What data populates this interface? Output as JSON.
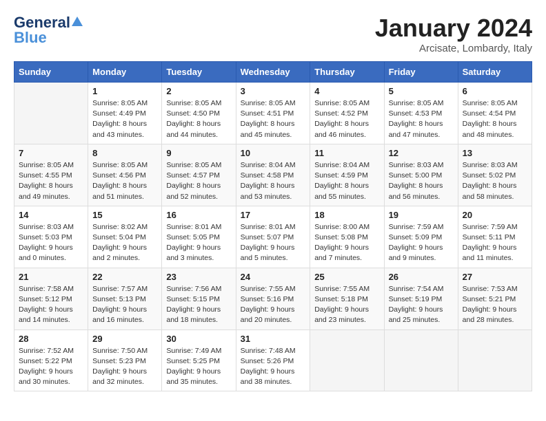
{
  "header": {
    "logo_general": "General",
    "logo_blue": "Blue",
    "month_title": "January 2024",
    "subtitle": "Arcisate, Lombardy, Italy"
  },
  "columns": [
    "Sunday",
    "Monday",
    "Tuesday",
    "Wednesday",
    "Thursday",
    "Friday",
    "Saturday"
  ],
  "weeks": [
    [
      {
        "day": "",
        "info": ""
      },
      {
        "day": "1",
        "info": "Sunrise: 8:05 AM\nSunset: 4:49 PM\nDaylight: 8 hours\nand 43 minutes."
      },
      {
        "day": "2",
        "info": "Sunrise: 8:05 AM\nSunset: 4:50 PM\nDaylight: 8 hours\nand 44 minutes."
      },
      {
        "day": "3",
        "info": "Sunrise: 8:05 AM\nSunset: 4:51 PM\nDaylight: 8 hours\nand 45 minutes."
      },
      {
        "day": "4",
        "info": "Sunrise: 8:05 AM\nSunset: 4:52 PM\nDaylight: 8 hours\nand 46 minutes."
      },
      {
        "day": "5",
        "info": "Sunrise: 8:05 AM\nSunset: 4:53 PM\nDaylight: 8 hours\nand 47 minutes."
      },
      {
        "day": "6",
        "info": "Sunrise: 8:05 AM\nSunset: 4:54 PM\nDaylight: 8 hours\nand 48 minutes."
      }
    ],
    [
      {
        "day": "7",
        "info": "Sunrise: 8:05 AM\nSunset: 4:55 PM\nDaylight: 8 hours\nand 49 minutes."
      },
      {
        "day": "8",
        "info": "Sunrise: 8:05 AM\nSunset: 4:56 PM\nDaylight: 8 hours\nand 51 minutes."
      },
      {
        "day": "9",
        "info": "Sunrise: 8:05 AM\nSunset: 4:57 PM\nDaylight: 8 hours\nand 52 minutes."
      },
      {
        "day": "10",
        "info": "Sunrise: 8:04 AM\nSunset: 4:58 PM\nDaylight: 8 hours\nand 53 minutes."
      },
      {
        "day": "11",
        "info": "Sunrise: 8:04 AM\nSunset: 4:59 PM\nDaylight: 8 hours\nand 55 minutes."
      },
      {
        "day": "12",
        "info": "Sunrise: 8:03 AM\nSunset: 5:00 PM\nDaylight: 8 hours\nand 56 minutes."
      },
      {
        "day": "13",
        "info": "Sunrise: 8:03 AM\nSunset: 5:02 PM\nDaylight: 8 hours\nand 58 minutes."
      }
    ],
    [
      {
        "day": "14",
        "info": "Sunrise: 8:03 AM\nSunset: 5:03 PM\nDaylight: 9 hours\nand 0 minutes."
      },
      {
        "day": "15",
        "info": "Sunrise: 8:02 AM\nSunset: 5:04 PM\nDaylight: 9 hours\nand 2 minutes."
      },
      {
        "day": "16",
        "info": "Sunrise: 8:01 AM\nSunset: 5:05 PM\nDaylight: 9 hours\nand 3 minutes."
      },
      {
        "day": "17",
        "info": "Sunrise: 8:01 AM\nSunset: 5:07 PM\nDaylight: 9 hours\nand 5 minutes."
      },
      {
        "day": "18",
        "info": "Sunrise: 8:00 AM\nSunset: 5:08 PM\nDaylight: 9 hours\nand 7 minutes."
      },
      {
        "day": "19",
        "info": "Sunrise: 7:59 AM\nSunset: 5:09 PM\nDaylight: 9 hours\nand 9 minutes."
      },
      {
        "day": "20",
        "info": "Sunrise: 7:59 AM\nSunset: 5:11 PM\nDaylight: 9 hours\nand 11 minutes."
      }
    ],
    [
      {
        "day": "21",
        "info": "Sunrise: 7:58 AM\nSunset: 5:12 PM\nDaylight: 9 hours\nand 14 minutes."
      },
      {
        "day": "22",
        "info": "Sunrise: 7:57 AM\nSunset: 5:13 PM\nDaylight: 9 hours\nand 16 minutes."
      },
      {
        "day": "23",
        "info": "Sunrise: 7:56 AM\nSunset: 5:15 PM\nDaylight: 9 hours\nand 18 minutes."
      },
      {
        "day": "24",
        "info": "Sunrise: 7:55 AM\nSunset: 5:16 PM\nDaylight: 9 hours\nand 20 minutes."
      },
      {
        "day": "25",
        "info": "Sunrise: 7:55 AM\nSunset: 5:18 PM\nDaylight: 9 hours\nand 23 minutes."
      },
      {
        "day": "26",
        "info": "Sunrise: 7:54 AM\nSunset: 5:19 PM\nDaylight: 9 hours\nand 25 minutes."
      },
      {
        "day": "27",
        "info": "Sunrise: 7:53 AM\nSunset: 5:21 PM\nDaylight: 9 hours\nand 28 minutes."
      }
    ],
    [
      {
        "day": "28",
        "info": "Sunrise: 7:52 AM\nSunset: 5:22 PM\nDaylight: 9 hours\nand 30 minutes."
      },
      {
        "day": "29",
        "info": "Sunrise: 7:50 AM\nSunset: 5:23 PM\nDaylight: 9 hours\nand 32 minutes."
      },
      {
        "day": "30",
        "info": "Sunrise: 7:49 AM\nSunset: 5:25 PM\nDaylight: 9 hours\nand 35 minutes."
      },
      {
        "day": "31",
        "info": "Sunrise: 7:48 AM\nSunset: 5:26 PM\nDaylight: 9 hours\nand 38 minutes."
      },
      {
        "day": "",
        "info": ""
      },
      {
        "day": "",
        "info": ""
      },
      {
        "day": "",
        "info": ""
      }
    ]
  ]
}
